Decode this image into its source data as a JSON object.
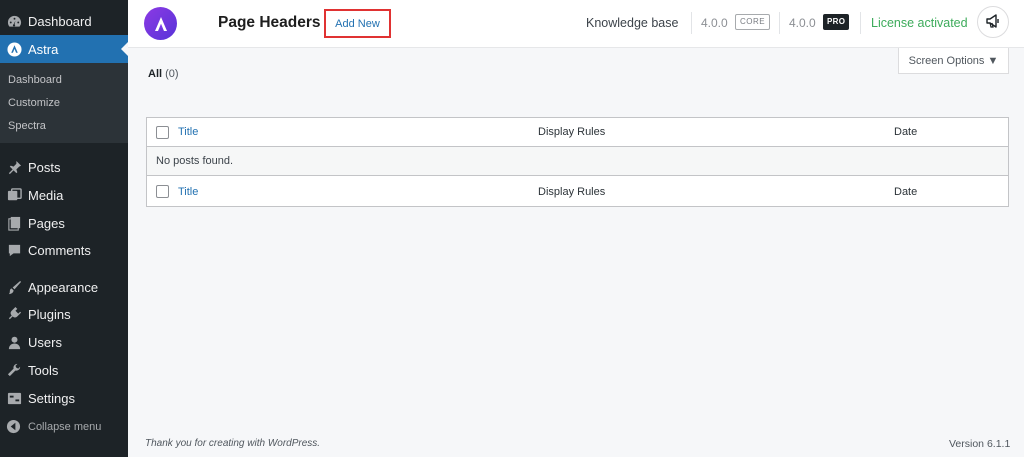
{
  "sidebar": {
    "items": [
      {
        "label": "Dashboard",
        "icon": "dashboard-icon"
      },
      {
        "label": "Astra",
        "icon": "astra-icon"
      },
      {
        "label": "Posts",
        "icon": "pin-icon"
      },
      {
        "label": "Media",
        "icon": "media-icon"
      },
      {
        "label": "Pages",
        "icon": "pages-icon"
      },
      {
        "label": "Comments",
        "icon": "comment-icon"
      },
      {
        "label": "Appearance",
        "icon": "brush-icon"
      },
      {
        "label": "Plugins",
        "icon": "plugin-icon"
      },
      {
        "label": "Users",
        "icon": "user-icon"
      },
      {
        "label": "Tools",
        "icon": "wrench-icon"
      },
      {
        "label": "Settings",
        "icon": "settings-icon"
      }
    ],
    "submenu": [
      {
        "label": "Dashboard"
      },
      {
        "label": "Customize"
      },
      {
        "label": "Spectra"
      }
    ],
    "collapse_label": "Collapse menu"
  },
  "header": {
    "page_title": "Page Headers",
    "add_new_label": "Add New",
    "knowledge_base": "Knowledge base",
    "core_version": "4.0.0",
    "core_badge": "CORE",
    "pro_version": "4.0.0",
    "pro_badge": "PRO",
    "license_status": "License activated"
  },
  "screen_options": {
    "label": "Screen Options ▼"
  },
  "filters": {
    "all_label": "All",
    "all_count": "(0)"
  },
  "table": {
    "columns": {
      "title": "Title",
      "display_rules": "Display Rules",
      "date": "Date"
    },
    "empty_message": "No posts found."
  },
  "footer": {
    "thanks": "Thank you for creating with WordPress.",
    "version": "Version 6.1.1"
  },
  "colors": {
    "sidebar_bg": "#1d2327",
    "active_blue": "#2271b1",
    "license_green": "#3dab5b",
    "highlight_red": "#e03232",
    "astra_purple": "#7c3aed"
  }
}
